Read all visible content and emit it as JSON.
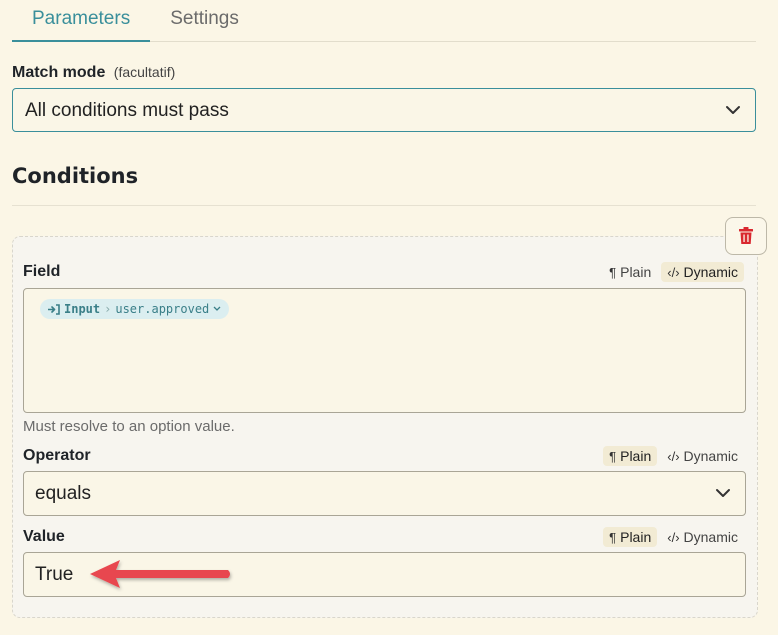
{
  "tabs": [
    {
      "label": "Parameters",
      "active": true
    },
    {
      "label": "Settings",
      "active": false
    }
  ],
  "match_mode": {
    "label": "Match mode",
    "optional": "(facultatif)",
    "value": "All conditions must pass"
  },
  "conditions": {
    "title": "Conditions",
    "field": {
      "label": "Field",
      "mode_plain": "Plain",
      "mode_dynamic": "Dynamic",
      "selected_mode": "Dynamic",
      "chip_source": "Input",
      "chip_path": "user.approved",
      "helper": "Must resolve to an option value."
    },
    "operator": {
      "label": "Operator",
      "mode_plain": "Plain",
      "mode_dynamic": "Dynamic",
      "selected_mode": "Plain",
      "value": "equals"
    },
    "value": {
      "label": "Value",
      "mode_plain": "Plain",
      "mode_dynamic": "Dynamic",
      "selected_mode": "Plain",
      "value": "True"
    }
  },
  "colors": {
    "accent": "#3a8f9b",
    "background": "#fbf6e6",
    "delete": "#d9282f",
    "annotation_arrow": "#e8474f"
  },
  "icons": [
    "chevron-down-icon",
    "trash-icon",
    "pilcrow-icon",
    "code-icon",
    "input-icon",
    "arrow-annotation-icon"
  ]
}
